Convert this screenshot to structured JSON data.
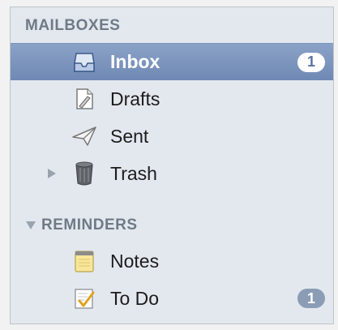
{
  "sidebar": {
    "mailboxes_header": "MAILBOXES",
    "reminders_header": "REMINDERS",
    "mailboxes": [
      {
        "label": "Inbox",
        "icon": "inbox-icon",
        "badge": "1"
      },
      {
        "label": "Drafts",
        "icon": "drafts-icon"
      },
      {
        "label": "Sent",
        "icon": "sent-icon"
      },
      {
        "label": "Trash",
        "icon": "trash-icon",
        "disclosure": "collapsed"
      }
    ],
    "reminders": [
      {
        "label": "Notes",
        "icon": "notes-icon"
      },
      {
        "label": "To Do",
        "icon": "todo-icon",
        "badge": "1"
      }
    ]
  },
  "colors": {
    "selection": "#7c93ba",
    "header_text": "#6f7a86",
    "panel_bg": "#e3e8ef"
  }
}
